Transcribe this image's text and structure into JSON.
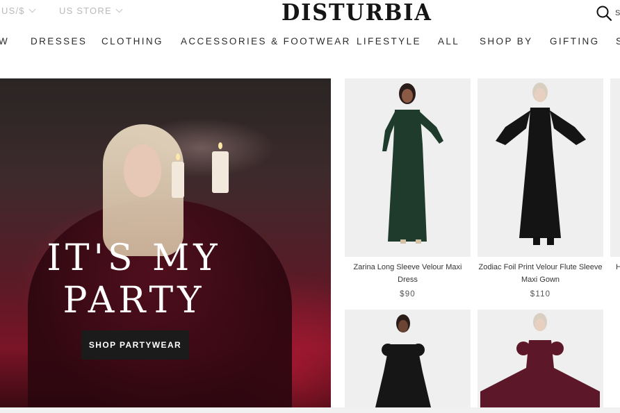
{
  "header": {
    "currency": "US/$",
    "store": "US STORE",
    "logo": "DISTURBIA",
    "search_label": "S"
  },
  "nav": {
    "items": [
      "W",
      "DRESSES",
      "CLOTHING",
      "ACCESSORIES & FOOTWEAR",
      "LIFESTYLE",
      "ALL",
      "SHOP BY",
      "GIFTING",
      "S"
    ]
  },
  "hero": {
    "title_line1": "IT'S MY",
    "title_line2": "PARTY",
    "button_label": "SHOP PARTYWEAR"
  },
  "products": [
    {
      "name_line1": "Zarina Long Sleeve Velour Maxi",
      "name_line2": "Dress",
      "price": "$90",
      "dress_color": "#1f3b2c"
    },
    {
      "name_line1": "Zodiac Foil Print Velour Flute Sleeve",
      "name_line2": "Maxi Gown",
      "price": "$110",
      "dress_color": "#141414"
    },
    {
      "dress_color": "#161616"
    },
    {
      "dress_color": "#5c1828"
    }
  ],
  "partial_product_name": "H"
}
